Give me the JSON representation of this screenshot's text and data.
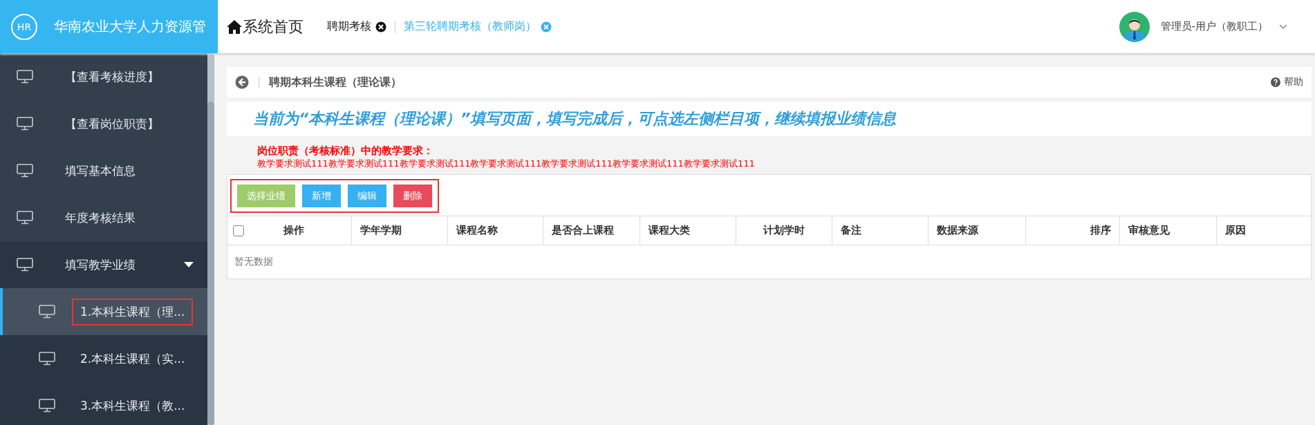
{
  "header": {
    "logo": "HR",
    "title": "华南农业大学人力资源管",
    "home": "系统首页",
    "tabs": [
      {
        "label": "聘期考核",
        "selected": false
      },
      {
        "label": "第三轮聘期考核（教师岗）",
        "selected": true
      }
    ],
    "user": "管理员-用户（教职工）"
  },
  "sidebar": {
    "items": [
      {
        "label": "【查看考核进度】",
        "selected": false
      },
      {
        "label": "【查看岗位职责】",
        "selected": false
      },
      {
        "label": "填写基本信息",
        "selected": false
      },
      {
        "label": "年度考核结果",
        "selected": false
      },
      {
        "label": "填写教学业绩",
        "selected": false,
        "expanded": true,
        "children": [
          {
            "label": "1.本科生课程（理...",
            "selected": true,
            "highlighted": true
          },
          {
            "label": "2.本科生课程（实...",
            "selected": false,
            "highlighted": false
          },
          {
            "label": "3.本科生课程（教...",
            "selected": false,
            "highlighted": false
          }
        ]
      }
    ]
  },
  "page": {
    "title": "聘期本科生课程（理论课）",
    "help": "帮助",
    "banner": "当前为“本科生课程（理论课）”填写页面，填写完成后，可点选左侧栏目项，继续填报业绩信息",
    "requirement_title": "岗位职责（考核标准）中的教学要求：",
    "requirement_text": "教学要求测试111教学要求测试111教学要求测试111教学要求测试111教学要求测试111教学要求测试111教学要求测试111",
    "toolbar": {
      "highlighted": true,
      "buttons": [
        {
          "label": "选择业绩",
          "kind": "success"
        },
        {
          "label": "新增",
          "kind": "primary"
        },
        {
          "label": "编辑",
          "kind": "primary"
        },
        {
          "label": "删除",
          "kind": "danger"
        }
      ]
    },
    "table": {
      "select_all_checked": false,
      "columns": [
        {
          "label": "操作"
        },
        {
          "label": "学年学期"
        },
        {
          "label": "课程名称"
        },
        {
          "label": "是否合上课程"
        },
        {
          "label": "课程大类"
        },
        {
          "label": "计划学时"
        },
        {
          "label": "备注"
        },
        {
          "label": "数据来源"
        },
        {
          "label": "排序"
        },
        {
          "label": "审核意见"
        },
        {
          "label": "原因"
        }
      ],
      "empty": "暂无数据"
    }
  }
}
